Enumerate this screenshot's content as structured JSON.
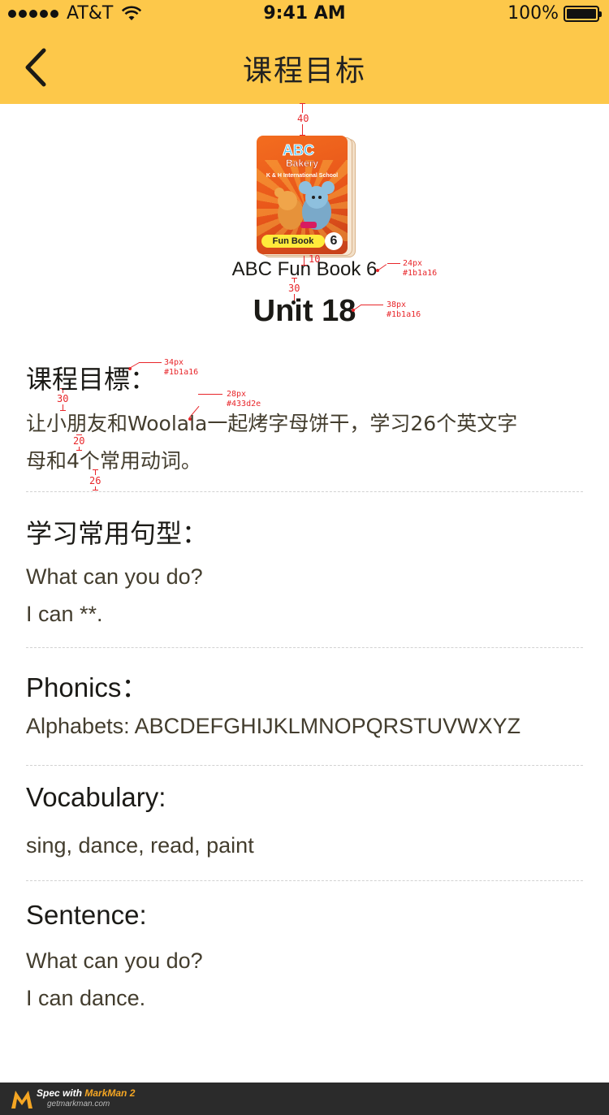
{
  "status_bar": {
    "carrier": "AT&T",
    "time": "9:41 AM",
    "battery": "100%"
  },
  "nav": {
    "title": "课程目标",
    "background": "#fdc84a"
  },
  "book": {
    "cover_logo_text": "ABC Bakery",
    "cover_school": "K & H International School",
    "cover_label": "Fun Book",
    "cover_number": "6",
    "title": "ABC Fun Book 6",
    "unit": "Unit 18"
  },
  "annotations": {
    "gap_top": "40",
    "gap_cover": "10",
    "gap_title": "30",
    "book_title_spec": [
      "24px",
      "#1b1a16"
    ],
    "unit_spec": [
      "38px",
      "#1b1a16"
    ],
    "heading_spec": [
      "34px",
      "#1b1a16"
    ],
    "gap_heading": "30",
    "text_spec": [
      "28px",
      "#433d2e"
    ],
    "gap_line": "20",
    "gap_bottom": "26"
  },
  "sections": [
    {
      "heading": "课程目標：",
      "lines": [
        "让小朋友和Woolala一起烤字母饼干，学习26个英文字",
        "母和4个常用动词。"
      ]
    },
    {
      "heading": "学习常用句型：",
      "lines": [
        "What can you do?",
        "I can **."
      ]
    },
    {
      "heading": "Phonics：",
      "lines": [
        "Alphabets: ABCDEFGHIJKLMNOPQRSTUVWXYZ"
      ]
    },
    {
      "heading": "Vocabulary:",
      "lines": [
        "sing, dance, read, paint"
      ]
    },
    {
      "heading": "Sentence:",
      "lines": [
        "What can you do?",
        "I can dance."
      ]
    }
  ],
  "footer": {
    "spec_with": "Spec with",
    "product": "MarkMan 2",
    "site": "getmarkman.com"
  }
}
